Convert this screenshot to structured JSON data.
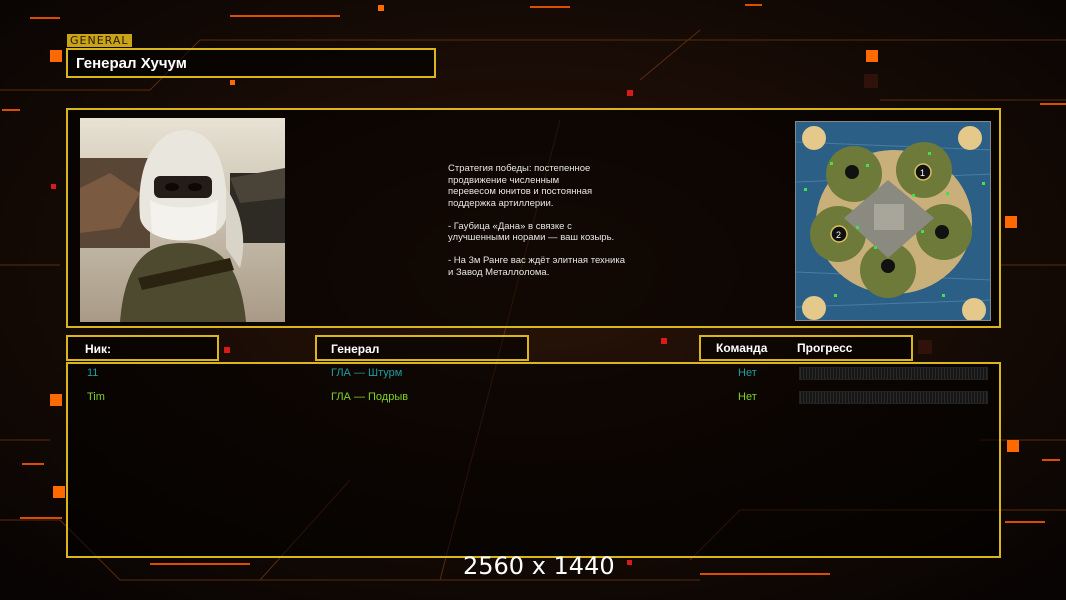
{
  "header": {
    "tag": "GENERAL",
    "general_name": "Генерал Хучум"
  },
  "briefing": {
    "text": "Стратегия победы: постепенное\nпродвижение численным\nперевесом юнитов и постоянная\nподдержка артиллерии.\n\n- Гаубица «Дана» в связке с\nулучшенными норами — ваш козырь.\n\n- На 3м Ранге вас ждёт элитная техника\nи Завод Металлолома."
  },
  "minimap": {
    "spawns": [
      "1",
      "2"
    ]
  },
  "columns": {
    "nick": "Ник:",
    "general": "Генерал",
    "team": "Команда",
    "progress": "Прогресс"
  },
  "players": [
    {
      "nick": "11",
      "general": "ГЛА — Штурм",
      "team": "Нет",
      "color": "#1e9e9e",
      "progress": 0
    },
    {
      "nick": "Tim",
      "general": "ГЛА — Подрыв",
      "team": "Нет",
      "color": "#7ed321",
      "progress": 0
    }
  ],
  "overlay": {
    "resolution": "2560 x 1440"
  },
  "colors": {
    "frame": "#d9b61c",
    "accent_orange": "#ff6a00"
  }
}
